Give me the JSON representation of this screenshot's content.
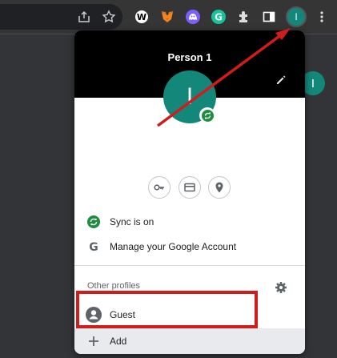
{
  "toolbar": {
    "icons": [
      "share-icon",
      "bookmark-star-icon",
      "extension-w-icon",
      "metamask-fox-icon",
      "extension-ghost-icon",
      "grammarly-g-icon",
      "extensions-puzzle-icon",
      "side-panel-icon",
      "profile-avatar-icon",
      "menu-kebab-icon"
    ],
    "avatar_letter": "I"
  },
  "page": {
    "avatar_letter": "I"
  },
  "popup": {
    "profile_name": "Person 1",
    "avatar_letter": "I",
    "sync_label": "Sync is on",
    "manage_label": "Manage your Google Account",
    "other_profiles_label": "Other profiles",
    "guest_label": "Guest",
    "add_label": "Add"
  },
  "colors": {
    "avatar": "#12877a",
    "annotation_red": "#d21c1c",
    "sync_green": "#1e8e3e"
  }
}
